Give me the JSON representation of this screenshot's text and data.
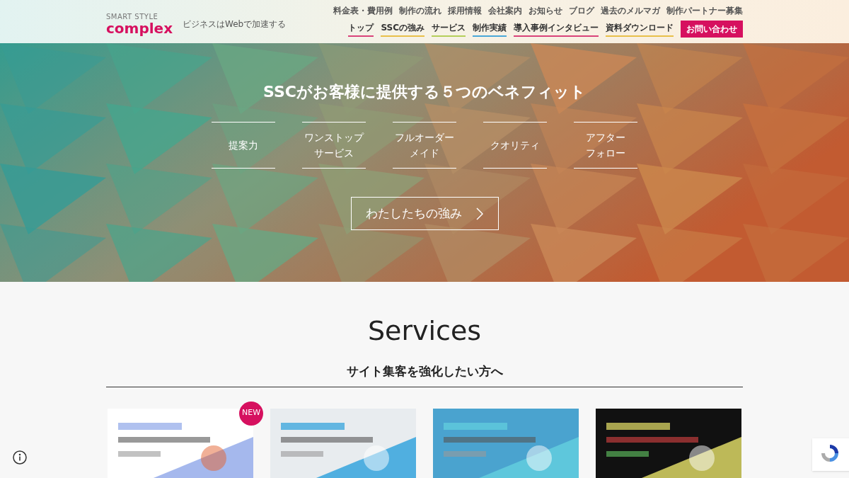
{
  "header": {
    "logo_top": "SMART STYLE",
    "logo_main": "complex",
    "tagline": "ビジネスはWebで加速する",
    "top_links": [
      "料金表・費用例",
      "制作の流れ",
      "採用情報",
      "会社案内",
      "お知らせ",
      "ブログ",
      "過去のメルマガ",
      "制作パートナー募集"
    ],
    "main_nav": [
      {
        "label": "トップ",
        "kind": "link",
        "color": "#d9437a"
      },
      {
        "label": "SSCの強み",
        "kind": "link",
        "color": "#e8c04a"
      },
      {
        "label": "サービス",
        "kind": "link",
        "color": "#b5cf5a"
      },
      {
        "label": "制作実績",
        "kind": "link",
        "color": "#4aa8d8"
      },
      {
        "label": "導入事例インタビュー",
        "kind": "link",
        "color": "#d9437a"
      },
      {
        "label": "資料ダウンロード",
        "kind": "link",
        "color": "#e8c04a"
      },
      {
        "label": "お問い合わせ",
        "kind": "cta",
        "color": "#d6105f"
      }
    ]
  },
  "hero": {
    "title": "SSCがお客様に提供する５つのベネフィット",
    "benefits": [
      [
        "提案力"
      ],
      [
        "ワンストップ",
        "サービス"
      ],
      [
        "フルオーダー",
        "メイド"
      ],
      [
        "クオリティ"
      ],
      [
        "アフター",
        "フォロー"
      ]
    ],
    "button": "わたしたちの強み"
  },
  "services": {
    "heading": "Services",
    "subheading": "サイト集客を強化したい方へ",
    "cards": [
      {
        "kind": "picture",
        "badge": "NEW"
      },
      {
        "kind": "picture"
      },
      {
        "kind": "picture"
      },
      {
        "kind": "picture"
      }
    ]
  }
}
